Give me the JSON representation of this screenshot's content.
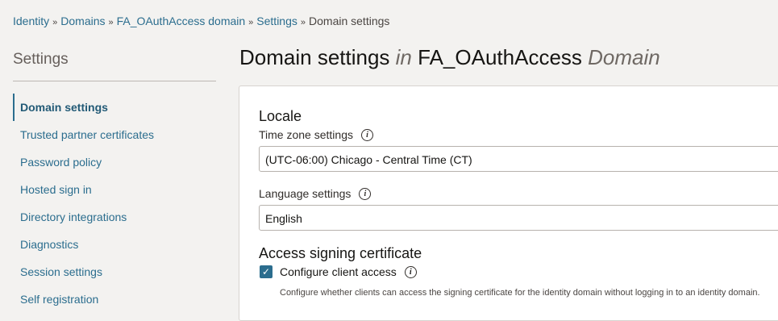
{
  "breadcrumb": {
    "items": [
      "Identity",
      "Domains",
      "FA_OAuthAccess domain",
      "Settings"
    ],
    "current": "Domain settings",
    "separator": "»"
  },
  "sidebar": {
    "title": "Settings",
    "items": [
      {
        "label": "Domain settings",
        "active": true
      },
      {
        "label": "Trusted partner certificates"
      },
      {
        "label": "Password policy"
      },
      {
        "label": "Hosted sign in"
      },
      {
        "label": "Directory integrations"
      },
      {
        "label": "Diagnostics"
      },
      {
        "label": "Session settings"
      },
      {
        "label": "Self registration"
      }
    ]
  },
  "page": {
    "title_part1": "Domain settings",
    "title_in": "in",
    "title_name": "FA_OAuthAccess",
    "title_suffix": "Domain"
  },
  "locale": {
    "heading": "Locale",
    "timezone_label": "Time zone settings",
    "timezone_value": "(UTC-06:00) Chicago - Central Time (CT)",
    "language_label": "Language settings",
    "language_value": "English"
  },
  "signing": {
    "heading": "Access signing certificate",
    "checkbox_label": "Configure client access",
    "checked": true,
    "help": "Configure whether clients can access the signing certificate for the identity domain without logging in to an identity domain."
  },
  "colors": {
    "accent": "#2b6d8e"
  },
  "icons": {
    "info": "info-icon",
    "check": "check-icon"
  }
}
